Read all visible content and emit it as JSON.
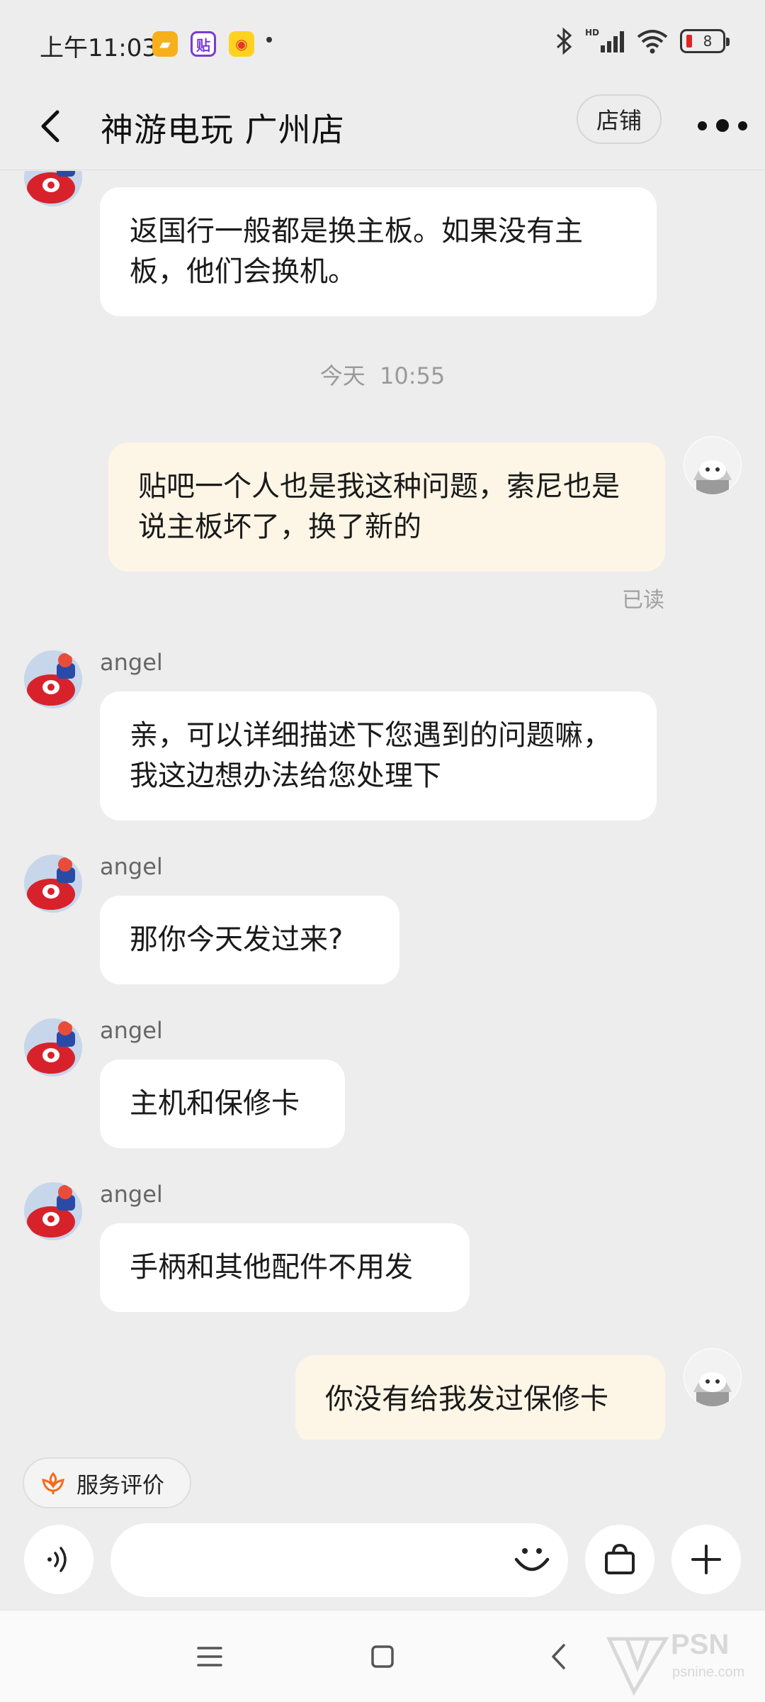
{
  "status_bar": {
    "time": "上午11:03",
    "battery": "8"
  },
  "header": {
    "title": "神游电玩 广州店",
    "shop_button": "店铺"
  },
  "messages": [
    {
      "side": "in",
      "text": "返国行一般都是换主板。如果没有主板，他们会换机。"
    },
    {
      "type": "timestamp",
      "text": "今天  10:55"
    },
    {
      "side": "out",
      "text": "贴吧一个人也是我这种问题，索尼也是说主板坏了，换了新的",
      "read": "已读"
    },
    {
      "side": "in",
      "sender": "angel",
      "text": "亲，可以详细描述下您遇到的问题嘛，我这边想办法给您处理下"
    },
    {
      "side": "in",
      "sender": "angel",
      "text": "那你今天发过来?"
    },
    {
      "side": "in",
      "sender": "angel",
      "text": "主机和保修卡"
    },
    {
      "side": "in",
      "sender": "angel",
      "text": "手柄和其他配件不用发"
    },
    {
      "side": "out",
      "text": "你没有给我发过保修卡"
    }
  ],
  "service_eval": {
    "label": "服务评价"
  },
  "input": {
    "placeholder": ""
  },
  "watermark": {
    "main": "PSN",
    "sub": "psnine.com"
  },
  "colors": {
    "incoming_bubble": "#ffffff",
    "outgoing_bubble": "#fdf5e6",
    "background": "#ededed",
    "accent": "#f26b1d"
  }
}
